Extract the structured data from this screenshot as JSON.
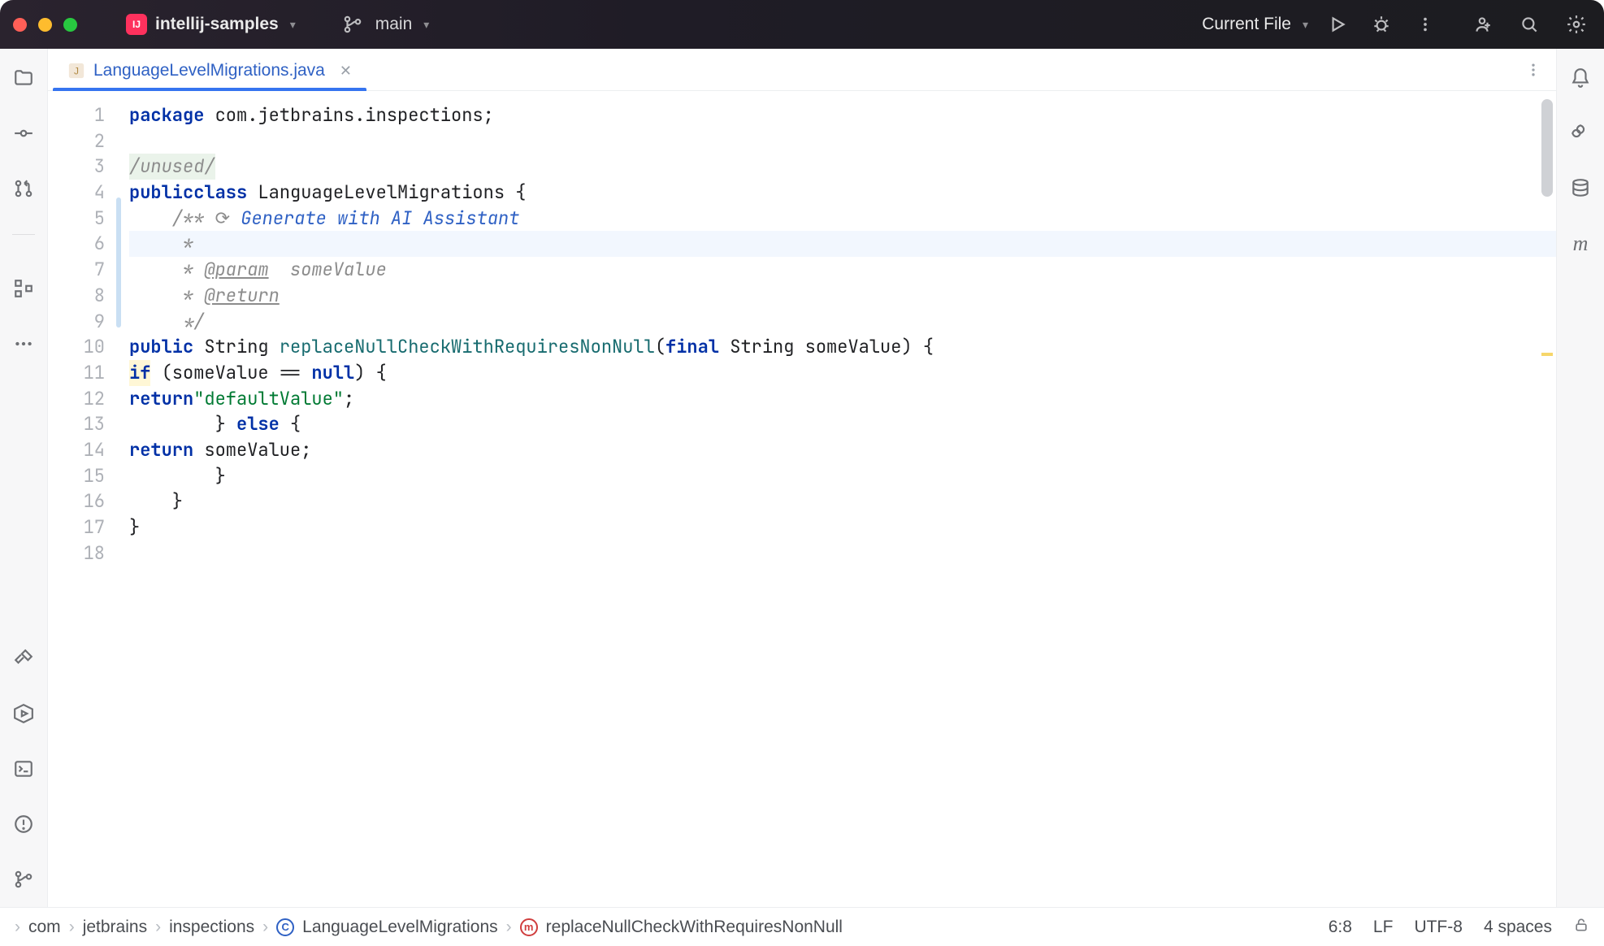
{
  "titlebar": {
    "project": "intellij-samples",
    "branch": "main",
    "run_config": "Current File"
  },
  "tab": {
    "filename": "LanguageLevelMigrations.java"
  },
  "editor": {
    "ai_hint": "Generate with AI Assistant",
    "current_line": 6,
    "lines": [
      {
        "n": 1,
        "kind": "pkg",
        "text": "package com.jetbrains.inspections;",
        "kw": "package",
        "rest": " com.jetbrains.inspections;"
      },
      {
        "n": 2,
        "kind": "blank",
        "text": ""
      },
      {
        "n": 3,
        "kind": "unused",
        "text": "/unused/"
      },
      {
        "n": 4,
        "kind": "cls",
        "kw1": "public",
        "kw2": "class",
        "name": "LanguageLevelMigrations",
        "tail": " {"
      },
      {
        "n": 5,
        "kind": "docopen",
        "prefix": "    /** ",
        "ai": true
      },
      {
        "n": 6,
        "kind": "doc",
        "text": "     *"
      },
      {
        "n": 7,
        "kind": "docparam",
        "prefix": "     * ",
        "tag": "@param",
        "rest": "  someValue"
      },
      {
        "n": 8,
        "kind": "docret",
        "prefix": "     * ",
        "tag": "@return"
      },
      {
        "n": 9,
        "kind": "doc",
        "text": "     */"
      },
      {
        "n": 10,
        "kind": "method",
        "indent": "    ",
        "kw1": "public",
        "type": "String",
        "name": "replaceNullCheckWithRequiresNonNull",
        "kw2": "final",
        "ptype": "String",
        "pname": "someValue",
        "tail": ") {"
      },
      {
        "n": 11,
        "kind": "if",
        "indent": "        ",
        "kw": "if",
        "mid": " (someValue == ",
        "kw2": "null",
        "tail": ") {"
      },
      {
        "n": 12,
        "kind": "ret1",
        "indent": "            ",
        "kw": "return",
        "str": "\"defaultValue\"",
        "tail": ";"
      },
      {
        "n": 13,
        "kind": "else",
        "indent": "        ",
        "pre": "} ",
        "kw": "else",
        "tail": " {"
      },
      {
        "n": 14,
        "kind": "ret2",
        "indent": "            ",
        "kw": "return",
        "rest": " someValue;"
      },
      {
        "n": 15,
        "kind": "plain",
        "text": "        }"
      },
      {
        "n": 16,
        "kind": "plain",
        "text": "    }"
      },
      {
        "n": 17,
        "kind": "plain",
        "text": "}"
      },
      {
        "n": 18,
        "kind": "blank",
        "text": ""
      }
    ]
  },
  "breadcrumbs": [
    "com",
    "jetbrains",
    "inspections",
    "LanguageLevelMigrations",
    "replaceNullCheckWithRequiresNonNull"
  ],
  "status": {
    "caret": "6:8",
    "line_sep": "LF",
    "encoding": "UTF-8",
    "indent": "4 spaces"
  }
}
